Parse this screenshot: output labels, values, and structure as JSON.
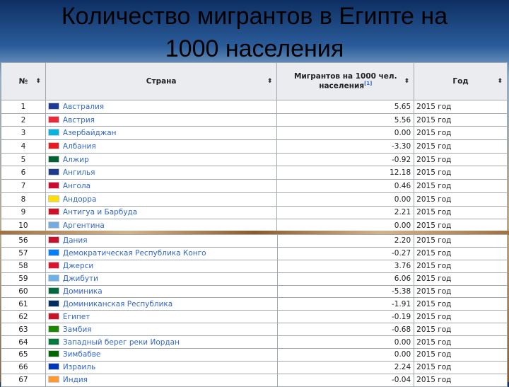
{
  "title": {
    "line1": "Количество мигрантов в Египте на",
    "line2": "1000 населения"
  },
  "table": {
    "headers": {
      "num": "№",
      "country": "Страна",
      "migrants": "Мигрантов на 1000 чел. населения",
      "ref": "[1]",
      "year": "Год",
      "sort_icon": "sort-icon"
    },
    "rows_top": [
      {
        "n": "1",
        "country": "Австралия",
        "value": "5.65",
        "year": "2015 год",
        "flag": "#1f3a93"
      },
      {
        "n": "2",
        "country": "Австрия",
        "value": "5.56",
        "year": "2015 год",
        "flag": "#ed2939"
      },
      {
        "n": "3",
        "country": "Азербайджан",
        "value": "0.00",
        "year": "2015 год",
        "flag": "#00b5e2"
      },
      {
        "n": "4",
        "country": "Албания",
        "value": "-3.30",
        "year": "2015 год",
        "flag": "#e41e20"
      },
      {
        "n": "5",
        "country": "Алжир",
        "value": "-0.92",
        "year": "2015 год",
        "flag": "#006233"
      },
      {
        "n": "6",
        "country": "Ангилья",
        "value": "12.18",
        "year": "2015 год",
        "flag": "#1f3a93"
      },
      {
        "n": "7",
        "country": "Ангола",
        "value": "0.46",
        "year": "2015 год",
        "flag": "#cc092f"
      },
      {
        "n": "8",
        "country": "Андорра",
        "value": "0.00",
        "year": "2015 год",
        "flag": "#fedf00"
      },
      {
        "n": "9",
        "country": "Антигуа и Барбуда",
        "value": "2.21",
        "year": "2015 год",
        "flag": "#ce1126"
      },
      {
        "n": "10",
        "country": "Аргентина",
        "value": "0.00",
        "year": "2015 год",
        "flag": "#74acdf"
      }
    ],
    "rows_bottom": [
      {
        "n": "56",
        "country": "Дания",
        "value": "2.20",
        "year": "2015 год",
        "flag": "#c8102e"
      },
      {
        "n": "57",
        "country": "Демократическая Республика Конго",
        "value": "-0.27",
        "year": "2015 год",
        "flag": "#007fff"
      },
      {
        "n": "58",
        "country": "Джерси",
        "value": "3.76",
        "year": "2015 год",
        "flag": "#df112d"
      },
      {
        "n": "59",
        "country": "Джибути",
        "value": "6.06",
        "year": "2015 год",
        "flag": "#6ab2e7"
      },
      {
        "n": "60",
        "country": "Доминика",
        "value": "-5.38",
        "year": "2015 год",
        "flag": "#006b3f"
      },
      {
        "n": "61",
        "country": "Доминиканская Республика",
        "value": "-1.91",
        "year": "2015 год",
        "flag": "#002d62"
      },
      {
        "n": "62",
        "country": "Египет",
        "value": "-0.19",
        "year": "2015 год",
        "flag": "#ce1126"
      },
      {
        "n": "63",
        "country": "Замбия",
        "value": "-0.68",
        "year": "2015 год",
        "flag": "#198a00"
      },
      {
        "n": "64",
        "country": "Западный берег реки Иордан",
        "value": "0.00",
        "year": "2015 год",
        "flag": "#007a3d"
      },
      {
        "n": "65",
        "country": "Зимбабве",
        "value": "0.00",
        "year": "2015 год",
        "flag": "#006400"
      },
      {
        "n": "66",
        "country": "Израиль",
        "value": "2.24",
        "year": "2015 год",
        "flag": "#0038b8"
      },
      {
        "n": "67",
        "country": "Индия",
        "value": "-0.04",
        "year": "2015 год",
        "flag": "#ff9933"
      }
    ]
  }
}
